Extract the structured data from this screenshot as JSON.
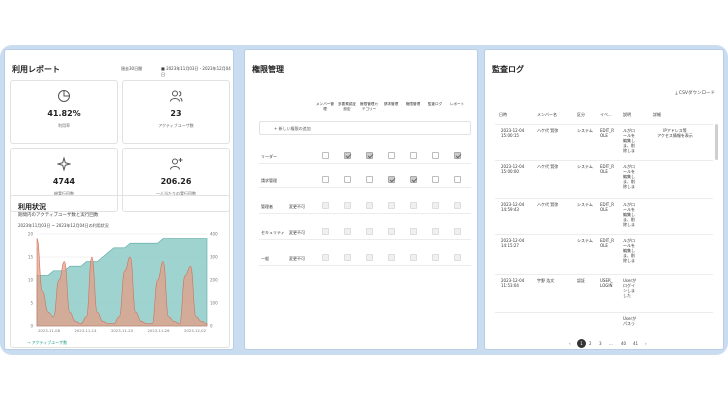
{
  "usage_report": {
    "title": "利用レポート",
    "period_select": "過去30日間",
    "date_range": "2023年11月03日 - 2023年12月04日",
    "kpis": [
      {
        "icon": "pie-chart-icon",
        "value": "41.82%",
        "label": "利用率"
      },
      {
        "icon": "users-icon",
        "value": "23",
        "label": "アクティブユーザ数"
      },
      {
        "icon": "sparkle-icon",
        "value": "4744",
        "label": "総実行回数"
      },
      {
        "icon": "user-plus-icon",
        "value": "206.26",
        "label": "一人当たりの実行回数"
      }
    ],
    "usage": {
      "title": "利用状況",
      "subtitle": "期間内のアクティブユーザ数と実行回数",
      "range_text": "2023年11月03日 ~ 2023年12月04日の利用状況",
      "legend": "アクティブユーザ数"
    }
  },
  "chart_data": {
    "type": "area",
    "x": [
      "2023-11-08",
      "2023-11-14",
      "2023-11-20",
      "2023-11-26",
      "2023-12-02"
    ],
    "ylim_left": [
      0,
      20
    ],
    "ylim_right": [
      0,
      400
    ],
    "left_ticks": [
      "20",
      "15",
      "10",
      "5",
      "0"
    ],
    "right_ticks": [
      "400",
      "300",
      "200",
      "100",
      "0"
    ],
    "series": [
      {
        "name": "アクティブユーザ数",
        "color": "#7fc4bf",
        "values": [
          11,
          11,
          11,
          12,
          12,
          12,
          13,
          13,
          13,
          14,
          14,
          14,
          15,
          16,
          17,
          17,
          17,
          18,
          18,
          18,
          18,
          18,
          18,
          19,
          19,
          19,
          19,
          19,
          19,
          19,
          19,
          19
        ]
      },
      {
        "color": "#e89a82",
        "values": [
          380,
          150,
          60,
          40,
          200,
          280,
          60,
          20,
          10,
          40,
          300,
          60,
          20,
          10,
          10,
          40,
          240,
          300,
          60,
          20,
          10,
          10,
          200,
          280,
          40,
          20,
          10,
          220,
          260,
          40,
          20,
          10
        ]
      }
    ]
  },
  "permissions": {
    "title": "権限管理",
    "columns": [
      "メンバー管理",
      "多要素認証設定",
      "権限管理カテゴリー",
      "請求管理",
      "権限管理",
      "監査ログ",
      "レポート"
    ],
    "add_label": "新しい権限の追加",
    "rows": [
      {
        "name": "リーダー",
        "sub": "",
        "checks": [
          "off",
          "on",
          "on",
          "off",
          "off",
          "off",
          "on"
        ]
      },
      {
        "name": "請求管理",
        "sub": "",
        "checks": [
          "off",
          "off",
          "off",
          "on",
          "on",
          "off",
          "off"
        ]
      },
      {
        "name": "管理者",
        "sub": "変更不可",
        "checks": [
          "dis",
          "dis",
          "dis",
          "dis",
          "dis",
          "dis",
          "dis"
        ]
      },
      {
        "name": "セキュリティ",
        "sub": "変更不可",
        "checks": [
          "dis",
          "dis",
          "dis",
          "dis",
          "dis",
          "dis",
          "dis"
        ]
      },
      {
        "name": "一般",
        "sub": "変更不可",
        "checks": [
          "dis",
          "dis",
          "dis",
          "dis",
          "dis",
          "dis",
          "dis"
        ]
      }
    ]
  },
  "audit": {
    "title": "監査ログ",
    "csv_label": "CSVダウンロード",
    "headers": [
      "日時",
      "メンバー名",
      "区分",
      "イベ...",
      "説明",
      "詳細"
    ],
    "rows": [
      {
        "date": "2023-12-04\n15:00:15",
        "member": "ハケ代 賢弥",
        "type": "システム",
        "event": "EDIT_R\nOLE",
        "desc": "ルがロールを編集しま、削除しま",
        "detail": "IPアドレス等\nアクセス情報を表示"
      },
      {
        "date": "2023-12-04\n15:00:00",
        "member": "ハケ代 賢弥",
        "type": "システム",
        "event": "EDIT_R\nOLE",
        "desc": "ルがロールを編集しま、削除しま",
        "detail": ""
      },
      {
        "date": "2023-12-04\n14:59:43",
        "member": "ハケ代 賢弥",
        "type": "システム",
        "event": "EDIT_R\nOLE",
        "desc": "ルがロールを編集しま、削除しま",
        "detail": ""
      },
      {
        "date": "2023-12-04\n14:15:27",
        "member": "",
        "type": "システム",
        "event": "EDIT_R\nOLE",
        "desc": "ルがロールを編集しま、削除しま",
        "detail": ""
      },
      {
        "date": "2023-12-04\n11:53:04",
        "member": "宇野 浩文",
        "type": "認証",
        "event": "USER_\nLOGIN",
        "desc": "Userがログインしました",
        "detail": ""
      },
      {
        "date": "",
        "member": "",
        "type": "",
        "event": "",
        "desc": "Userがパスヮ",
        "detail": ""
      }
    ],
    "pagination": [
      "1",
      "2",
      "3",
      "...",
      "40",
      "41"
    ]
  }
}
